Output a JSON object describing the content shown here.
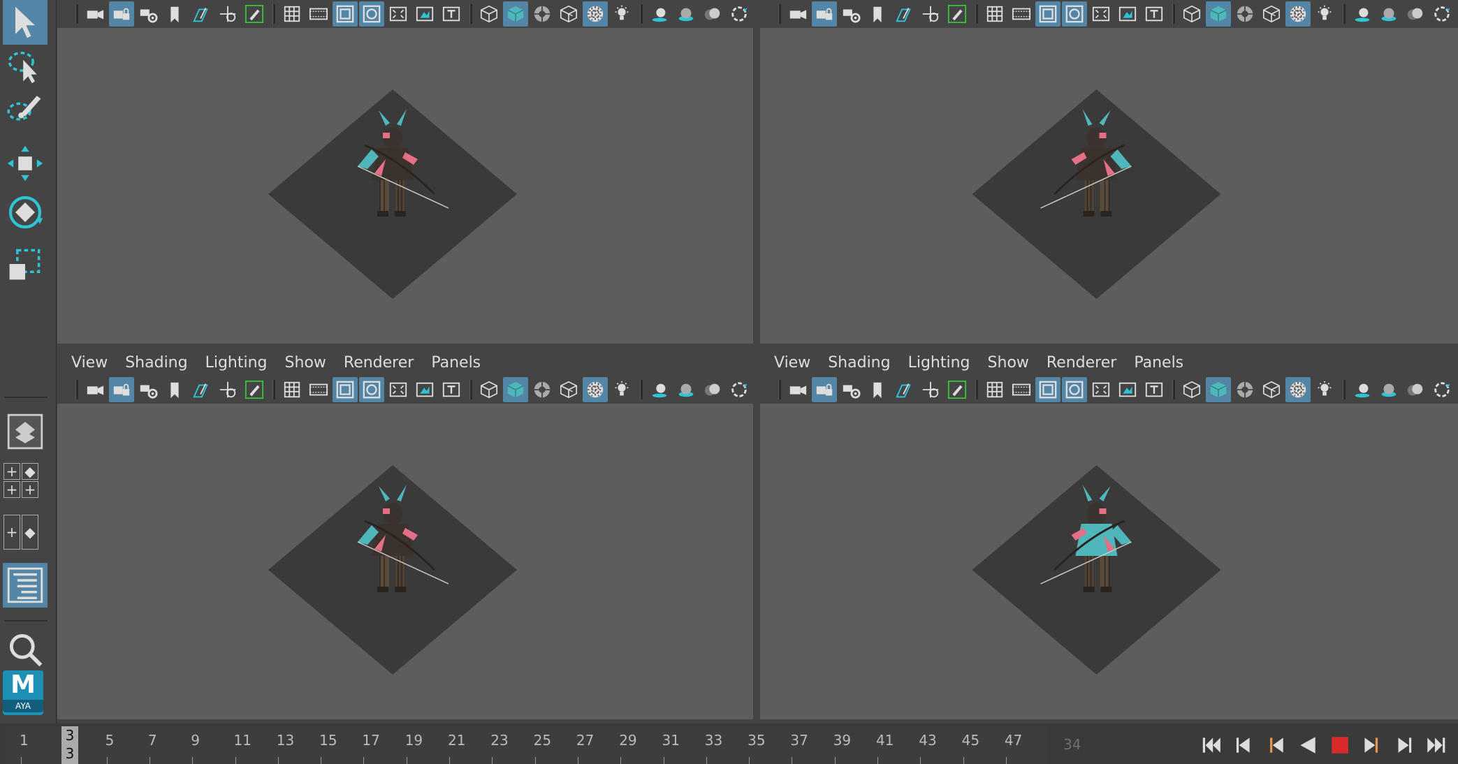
{
  "panel_menu": [
    "View",
    "Shading",
    "Lighting",
    "Show",
    "Renderer",
    "Panels"
  ],
  "timeline": {
    "current_frame": "3",
    "frame_labels": [
      "1",
      "3",
      "5",
      "7",
      "9",
      "11",
      "13",
      "15",
      "17",
      "19",
      "21",
      "23",
      "25",
      "27",
      "29",
      "31",
      "33",
      "35",
      "37",
      "39",
      "41",
      "43",
      "45",
      "47"
    ],
    "current_time_field": "34"
  },
  "logo": {
    "letter": "M",
    "label": "AYA"
  },
  "colors": {
    "background": "#444444",
    "viewport": "#5d5d5d",
    "ground_plane": "#3a3a3a",
    "accent": "#5285a6",
    "cloak": "#4fb6bc",
    "pink": "#e46f86",
    "stop": "#d92b2b"
  },
  "icons": {
    "toolbox": [
      "select-arrow-icon",
      "lasso-select-icon",
      "paint-select-icon",
      "move-tool-icon",
      "rotate-tool-icon",
      "scale-tool-icon"
    ],
    "viewport_toolbar": [
      "camera-icon",
      "lock-camera-icon",
      "camera-attributes-icon",
      "bookmark-icon",
      "image-plane-icon",
      "two-d-pan-icon",
      "grease-pencil-icon",
      "grid-icon",
      "film-gate-icon",
      "resolution-gate-icon",
      "gate-mask-icon",
      "field-chart-icon",
      "safe-action-icon",
      "safe-title-icon",
      "wireframe-icon",
      "smooth-shade-icon",
      "wireframe-on-shaded-icon",
      "use-default-material-icon",
      "textured-icon",
      "use-all-lights-icon",
      "shadows-icon",
      "screen-space-ao-icon",
      "motion-blur-icon",
      "anti-aliasing-icon"
    ],
    "playback": [
      "go-to-start-icon",
      "step-back-key-icon",
      "step-back-frame-icon",
      "play-backwards-icon",
      "stop-icon",
      "step-forward-frame-icon",
      "step-forward-key-icon",
      "go-to-end-icon"
    ]
  }
}
